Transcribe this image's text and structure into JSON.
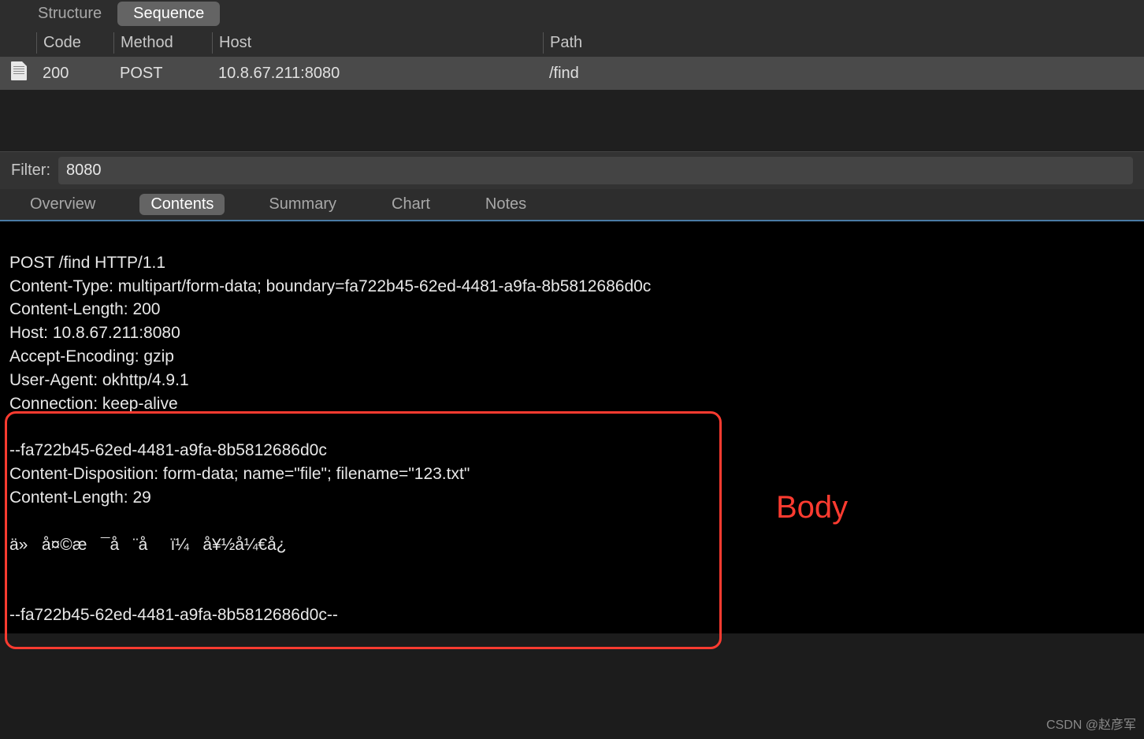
{
  "top_tabs": {
    "structure": "Structure",
    "sequence": "Sequence"
  },
  "list_header": {
    "code": "Code",
    "method": "Method",
    "host": "Host",
    "path": "Path"
  },
  "request_row": {
    "code": "200",
    "method": "POST",
    "host": "10.8.67.211:8080",
    "path": "/find"
  },
  "filter": {
    "label": "Filter:",
    "value": "8080"
  },
  "detail_tabs": {
    "overview": "Overview",
    "contents": "Contents",
    "summary": "Summary",
    "chart": "Chart",
    "notes": "Notes"
  },
  "http_content": {
    "request_line": "POST /find HTTP/1.1",
    "content_type": "Content-Type: multipart/form-data; boundary=fa722b45-62ed-4481-a9fa-8b5812686d0c",
    "content_length": "Content-Length: 200",
    "host": "Host: 10.8.67.211:8080",
    "accept_encoding": "Accept-Encoding: gzip",
    "user_agent": "User-Agent: okhttp/4.9.1",
    "connection": "Connection: keep-alive",
    "boundary_start": "--fa722b45-62ed-4481-a9fa-8b5812686d0c",
    "disposition": "Content-Disposition: form-data; name=\"file\"; filename=\"123.txt\"",
    "part_length": "Content-Length: 29",
    "body_data": "ä»   å¤©æ   ¯å   ¨å     ï¼   å¥½å¼€å¿",
    "boundary_end": "--fa722b45-62ed-4481-a9fa-8b5812686d0c--"
  },
  "annotation": {
    "body_label": "Body"
  },
  "watermark": "CSDN @赵彦军"
}
